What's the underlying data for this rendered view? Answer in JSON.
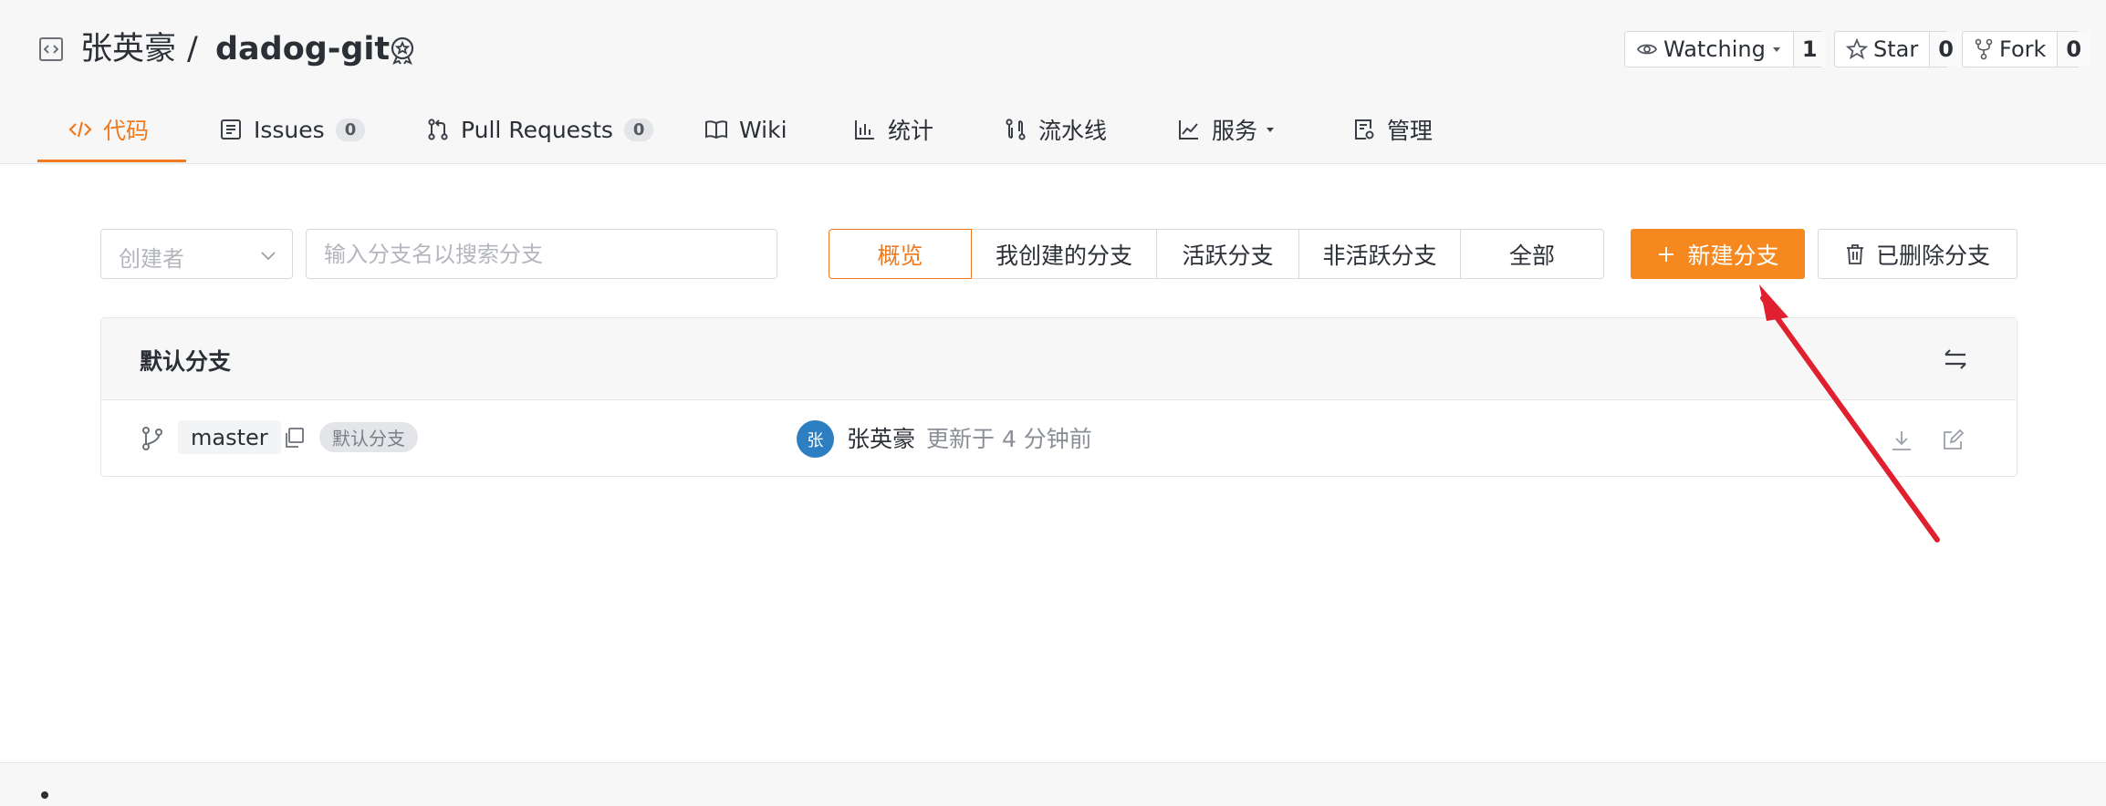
{
  "repo": {
    "owner": "张英豪",
    "separator": "/",
    "name": "dadog-git"
  },
  "header_actions": {
    "watch": {
      "label": "Watching",
      "count": "1"
    },
    "star": {
      "label": "Star",
      "count": "0"
    },
    "fork": {
      "label": "Fork",
      "count": "0"
    }
  },
  "tabs": [
    {
      "label": "代码",
      "icon": "code-icon",
      "active": true
    },
    {
      "label": "Issues",
      "count": "0",
      "icon": "issues-icon"
    },
    {
      "label": "Pull Requests",
      "count": "0",
      "icon": "pull-request-icon"
    },
    {
      "label": "Wiki",
      "icon": "book-icon"
    },
    {
      "label": "统计",
      "icon": "bar-chart-icon"
    },
    {
      "label": "流水线",
      "icon": "pipeline-icon"
    },
    {
      "label": "服务",
      "icon": "line-chart-icon"
    },
    {
      "label": "管理",
      "icon": "settings-doc-icon"
    }
  ],
  "filters": {
    "creator_placeholder": "创建者",
    "search_placeholder": "输入分支名以搜索分支",
    "segments": [
      "概览",
      "我创建的分支",
      "活跃分支",
      "非活跃分支",
      "全部"
    ],
    "new_branch": "新建分支",
    "deleted_branches": "已删除分支"
  },
  "panel": {
    "title": "默认分支",
    "branch": {
      "name": "master",
      "tag": "默认分支",
      "avatar_text": "张",
      "author": "张英豪",
      "updated": "更新于 4 分钟前"
    }
  },
  "colors": {
    "accent": "#ef7a1f",
    "button_bg": "#f5881f",
    "avatar_bg": "#2d7fc1",
    "annotation_arrow": "#e0202f"
  }
}
